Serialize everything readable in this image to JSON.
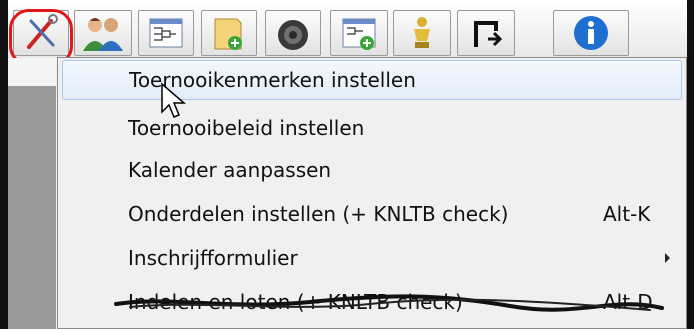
{
  "toolbar": {
    "buttons": [
      {
        "icon": "tools-icon"
      },
      {
        "icon": "users-icon"
      },
      {
        "icon": "draw-schedule-icon"
      },
      {
        "icon": "folder-add-icon"
      },
      {
        "icon": "tennis-ball-icon"
      },
      {
        "icon": "draw-schedule-add-icon"
      },
      {
        "icon": "trophy-icon"
      },
      {
        "icon": "exit-icon"
      },
      {
        "icon": "info-icon"
      }
    ]
  },
  "menu": {
    "items": [
      {
        "label": "Toernooikenmerken instellen",
        "shortcut": "",
        "highlighted": true
      },
      {
        "label": "Toernooibeleid instellen",
        "shortcut": ""
      },
      {
        "label": "Kalender aanpassen",
        "shortcut": ""
      },
      {
        "label": "Onderdelen instellen (+ KNLTB check)",
        "shortcut": "Alt-K"
      },
      {
        "label": "Inschrijfformulier",
        "shortcut": "",
        "submenu": true
      },
      {
        "label": "Indelen en loten (+ KNLTB check)",
        "shortcut": "Alt-D",
        "struck_out": true
      }
    ]
  },
  "colors": {
    "highlight_ring": "#e01818",
    "menu_highlight": "#e2ecf8",
    "menu_bg": "#f0f0f0"
  }
}
